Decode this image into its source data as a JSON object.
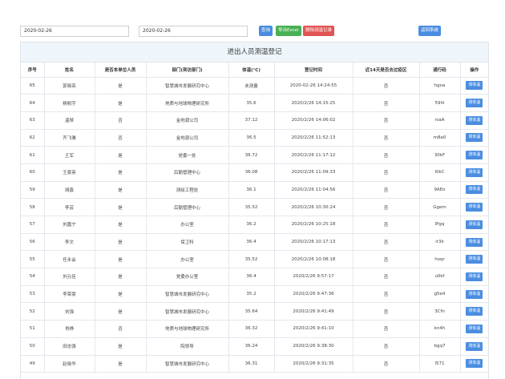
{
  "filters": {
    "start_date": "2020-02-26",
    "end_date": "2020-02-26"
  },
  "toolbar": {
    "search_label": "查询",
    "export_label": "导出Excel",
    "delete_label": "删除测温记录",
    "back_label": "返回系统",
    "colors": {
      "blue": "#4a8de0",
      "green": "#4ab055",
      "red": "#e15454"
    }
  },
  "table": {
    "title": "进出人员测温登记",
    "headers": [
      "序号",
      "姓名",
      "是否本单位人员",
      "部门(到访部门)",
      "体温(℃)",
      "登记时间",
      "近14天是否去过疫区",
      "通行码",
      "操作"
    ],
    "action_label": "测体温",
    "rows": [
      [
        "65",
        "郭晓亮",
        "是",
        "智慧城市发展研究中心",
        "未测量",
        "2020-02-26 14:24:55",
        "否",
        "hgoa"
      ],
      [
        "64",
        "杨帆宇",
        "是",
        "地质与地球物理研究所",
        "35.6",
        "2020/2/26 14:15:25",
        "否",
        "59hl"
      ],
      [
        "63",
        "温琴",
        "否",
        "金地源公司",
        "37.12",
        "2020/2/26 14:06:02",
        "否",
        "niaA"
      ],
      [
        "62",
        "齐飞雅",
        "否",
        "金地源公司",
        "36.5",
        "2020/2/26 11:52:13",
        "否",
        "m8e0"
      ],
      [
        "61",
        "王军",
        "是",
        "党委一处",
        "36.72",
        "2020/2/26 11:17:12",
        "否",
        "30kF"
      ],
      [
        "60",
        "王豪英",
        "是",
        "后勤管理中心",
        "36.08",
        "2020/2/26 11:09:33",
        "否",
        "l0kC"
      ],
      [
        "59",
        "胡鑫",
        "是",
        "测绘工程处",
        "36.1",
        "2020/2/26 11:04:56",
        "否",
        "9AEo"
      ],
      [
        "58",
        "李芸",
        "是",
        "后勤管理中心",
        "35.52",
        "2020/2/26 10:30:24",
        "否",
        "Ggem"
      ],
      [
        "57",
        "刘嘉宁",
        "是",
        "办公室",
        "36.2",
        "2020/2/26 10:25:18",
        "否",
        "lPgq"
      ],
      [
        "56",
        "李文",
        "是",
        "保卫科",
        "36.4",
        "2020/2/26 10:17:13",
        "否",
        "ir3k"
      ],
      [
        "55",
        "任永会",
        "是",
        "办公室",
        "35.52",
        "2020/2/26 10:08:18",
        "否",
        "hoqr"
      ],
      [
        "54",
        "刘元佳",
        "是",
        "党委办公室",
        "36.4",
        "2020/2/26 9:57:17",
        "否",
        "u0kf"
      ],
      [
        "53",
        "李荣豪",
        "是",
        "智慧城市发展研究中心",
        "35.2",
        "2020/2/26 9:47:36",
        "否",
        "g5e4"
      ],
      [
        "52",
        "刘强",
        "是",
        "智慧城市发展研究中心",
        "35.64",
        "2020/2/26 9:41:49",
        "否",
        "3Cfn"
      ],
      [
        "51",
        "肖峥",
        "否",
        "地质与地球物理研究所",
        "36.32",
        "2020/2/26 9:41:10",
        "否",
        "kn4h"
      ],
      [
        "50",
        "田志强",
        "是",
        "院领导",
        "36.24",
        "2020/2/26 9:38:30",
        "否",
        "bgq7"
      ],
      [
        "49",
        "赵晓华",
        "是",
        "智慧城市发展研究中心",
        "36.31",
        "2020/2/26 9:31:35",
        "否",
        "l571"
      ]
    ]
  }
}
